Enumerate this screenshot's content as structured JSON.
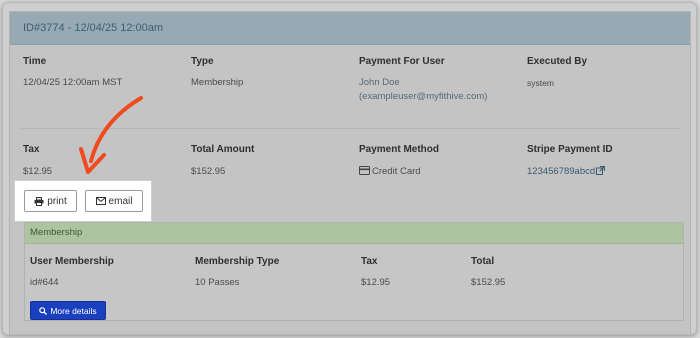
{
  "header": {
    "title": "ID#3774 - 12/04/25 12:00am"
  },
  "row1": {
    "time": {
      "label": "Time",
      "value": "12/04/25 12:00am MST"
    },
    "type": {
      "label": "Type",
      "value": "Membership"
    },
    "payment_for_user": {
      "label": "Payment For User",
      "name": "John Doe",
      "username": "(exampleuser@myfithive.com)"
    },
    "executed_by": {
      "label": "Executed By",
      "value": "system"
    }
  },
  "row2": {
    "tax": {
      "label": "Tax",
      "value": "$12.95"
    },
    "total_amount": {
      "label": "Total Amount",
      "value": "$152.95"
    },
    "payment_method": {
      "label": "Payment Method",
      "value": "Credit Card",
      "icon": "credit-card-icon"
    },
    "stripe_payment_id": {
      "label": "Stripe Payment ID",
      "value": "123456789abcd",
      "icon": "external-link-icon"
    }
  },
  "actions": {
    "print_label": "print",
    "print_icon": "printer-icon",
    "email_label": "email",
    "email_icon": "envelope-icon"
  },
  "membership": {
    "title": "Membership",
    "columns": [
      "User Membership",
      "Membership Type",
      "Tax",
      "Total"
    ],
    "rows": [
      [
        "id#644",
        "10 Passes",
        "$12.95",
        "$152.95"
      ]
    ],
    "more_details_label": "More details",
    "more_details_icon": "search-icon"
  },
  "colors": {
    "annotation_arrow": "#f04a1e",
    "header_bg": "#97aab4",
    "membership_header_bg": "#aec4a0",
    "primary_button": "#1a3fbf"
  }
}
